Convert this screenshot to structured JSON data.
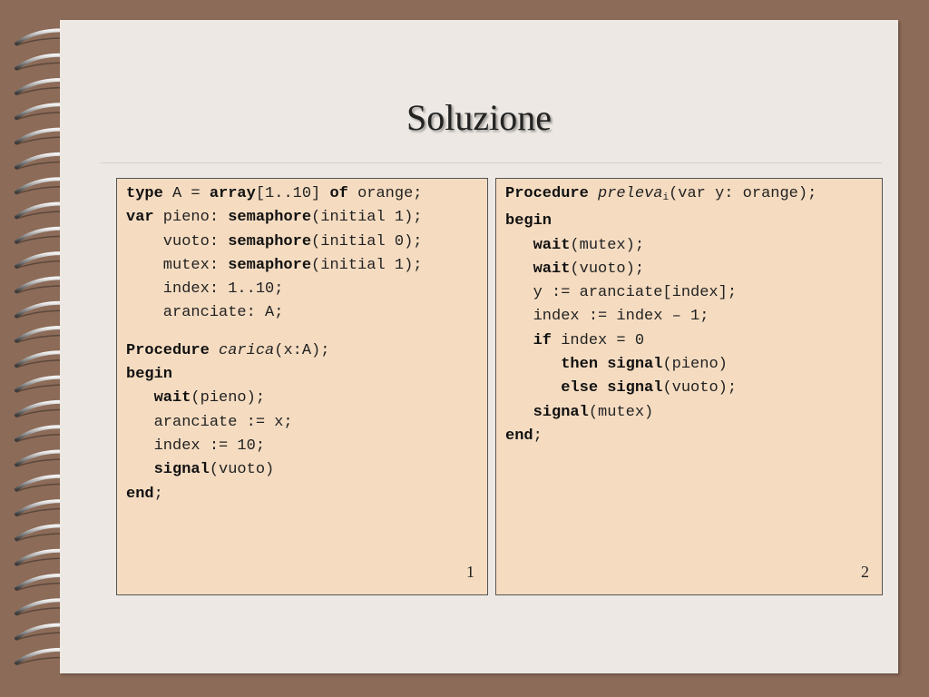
{
  "slide": {
    "title": "Soluzione"
  },
  "box1": {
    "page_number": "1",
    "lines": [
      {
        "k1": "type",
        "t1": " A = ",
        "k2": "array",
        "t2": "[1..10] ",
        "k3": "of",
        "t3": " orange;"
      },
      {
        "k1": "var",
        "t1": " pieno: ",
        "k2": "semaphore",
        "t2": "(initial 1);"
      },
      {
        "t0": "    vuoto: ",
        "k2": "semaphore",
        "t2": "(initial 0);"
      },
      {
        "t0": "    mutex: ",
        "k2": "semaphore",
        "t2": "(initial 1);"
      },
      {
        "t0": "    index: 1..10;"
      },
      {
        "t0": "    aranciate: A;"
      },
      {
        "k1": "Procedure",
        "t1": " ",
        "it": "carica",
        "t2": "(x:A);"
      },
      {
        "k1": "begin"
      },
      {
        "t0": "   ",
        "k1": "wait",
        "t1": "(pieno);"
      },
      {
        "t0": "   aranciate := x;"
      },
      {
        "t0": "   index := 10;"
      },
      {
        "t0": "   ",
        "k1": "signal",
        "t1": "(vuoto)"
      },
      {
        "k1": "end",
        "t1": ";"
      }
    ]
  },
  "box2": {
    "page_number": "2",
    "lines": [
      {
        "k1": "Procedure",
        "t1": " ",
        "it": "preleva",
        "sub": "i",
        "t2": "(var y: orange);"
      },
      {
        "k1": "begin"
      },
      {
        "t0": "   ",
        "k1": "wait",
        "t1": "(mutex);"
      },
      {
        "t0": "   ",
        "k1": "wait",
        "t1": "(vuoto);"
      },
      {
        "t0": "   y := aranciate[index];"
      },
      {
        "t0": "   index := index – 1;"
      },
      {
        "t0": "   ",
        "k1": "if",
        "t1": " index = 0"
      },
      {
        "t0": "      ",
        "k1": "then",
        "t1": " ",
        "k2": "signal",
        "t2": "(pieno)"
      },
      {
        "t0": "      ",
        "k1": "else",
        "t1": " ",
        "k2": "signal",
        "t2": "(vuoto);"
      },
      {
        "t0": "   ",
        "k1": "signal",
        "t1": "(mutex)"
      },
      {
        "k1": "end",
        "t1": ";"
      }
    ]
  }
}
